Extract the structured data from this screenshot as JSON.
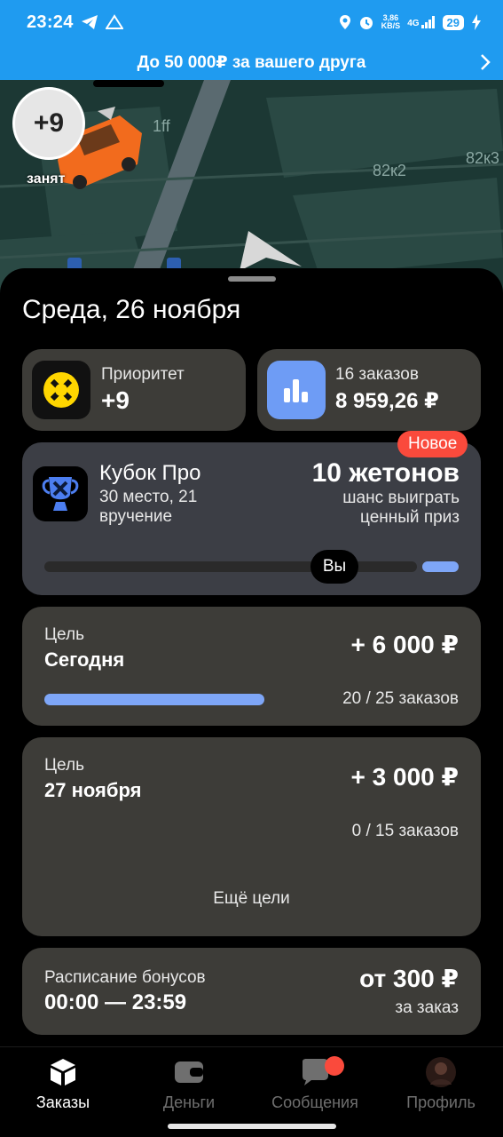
{
  "status_bar": {
    "time": "23:24",
    "speed_top": "3,86",
    "speed_bottom": "KB/S",
    "network": "4G",
    "battery": "29"
  },
  "promo": {
    "text": "До 50 000₽ за вашего друга"
  },
  "map": {
    "labels": [
      "1ff",
      "82к2",
      "82к3"
    ],
    "badge_value": "+9",
    "badge_status": "занят"
  },
  "sheet": {
    "date_title": "Среда, 26 ноября",
    "priority": {
      "label": "Приоритет",
      "value": "+9"
    },
    "orders": {
      "count_text": "16 заказов",
      "amount": "8 959,26 ₽"
    },
    "cup": {
      "badge": "Новое",
      "title": "Кубок Про",
      "place_line1": "30 место, 21",
      "place_line2": "вручение",
      "tokens": "10 жетонов",
      "chance_line1": "шанс выиграть",
      "chance_line2": "ценный приз",
      "you_label": "Вы",
      "progress": 0.8
    },
    "goal_today": {
      "label": "Цель",
      "title": "Сегодня",
      "reward": "+ 6 000 ₽",
      "progress_text": "20 / 25 заказов",
      "progress": 0.8
    },
    "goal_next": {
      "label": "Цель",
      "title": "27 ноября",
      "reward": "+ 3 000 ₽",
      "progress_text": "0 / 15 заказов",
      "more_link": "Ещё цели"
    },
    "bonus_schedule": {
      "label": "Расписание бонусов",
      "time_range": "00:00 — 23:59",
      "amount": "от 300 ₽",
      "per": "за заказ"
    }
  },
  "nav": {
    "items": [
      {
        "label": "Заказы",
        "icon": "cube-icon",
        "active": true
      },
      {
        "label": "Деньги",
        "icon": "wallet-icon",
        "active": false
      },
      {
        "label": "Сообщения",
        "icon": "chat-icon",
        "active": false
      },
      {
        "label": "Профиль",
        "icon": "avatar-icon",
        "active": false
      }
    ]
  },
  "colors": {
    "accent_blue": "#1f9bf0",
    "progress_blue": "#7ea6f7",
    "badge_red": "#fa4a3c",
    "card_bg": "#3d3c38",
    "priority_yellow": "#ffd600"
  }
}
